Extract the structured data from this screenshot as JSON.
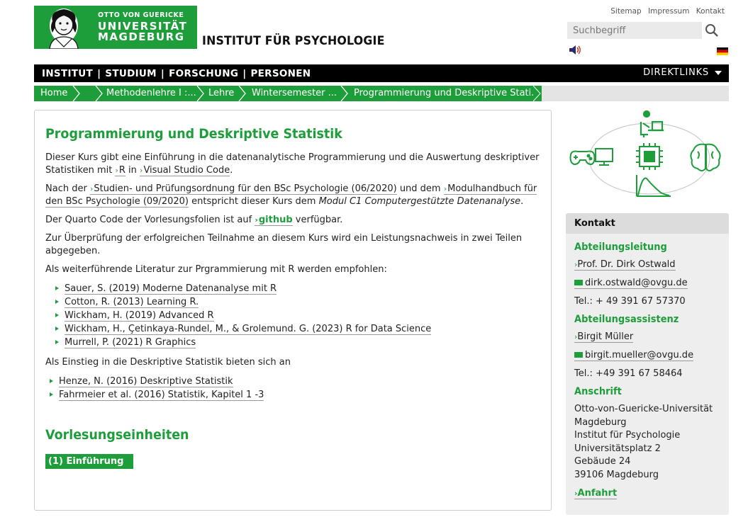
{
  "header": {
    "logo_small": "OTTO VON GUERICKE",
    "logo_line1": "UNIVERSITÄT",
    "logo_line2": "MAGDEBURG",
    "institute_title": "INSTITUT FÜR PSYCHOLOGIE",
    "toplinks": [
      "Sitemap",
      "Impressum",
      "Kontakt"
    ],
    "search_placeholder": "Suchbegriff"
  },
  "mainnav": {
    "items": [
      "INSTITUT",
      "STUDIUM",
      "FORSCHUNG",
      "PERSONEN"
    ],
    "direktlinks": "DIREKTLINKS"
  },
  "breadcrumb": [
    "Home",
    "",
    "Methodenlehre I :...",
    "Lehre",
    "Wintersemester ...",
    "Programmierung und Deskriptive Stati..."
  ],
  "main": {
    "title": "Programmierung und Deskriptive Statistik",
    "p1_a": "Dieser Kurs gibt eine Einführung in die datenanalytische Programmierung und die Auswertung deskriptiver Statistiken mit ",
    "p1_link1": "R",
    "p1_b": " in ",
    "p1_link2": "Visual Studio Code",
    "p1_c": ".",
    "p2_a": "Nach der ",
    "p2_link1": "Studien- und Prüfungsordnung für den BSc Psychologie (06/2020)",
    "p2_b": " und dem ",
    "p2_link2": "Modulhandbuch für den BSc Psychologie (09/2020)",
    "p2_c": " entspricht dieser Kurs dem ",
    "p2_em": "Modul C1 Computergestützte Datenanalyse",
    "p2_d": ".",
    "p3_a": "Der Quarto Code der Vorlesungsfolien ist auf ",
    "p3_link": "github",
    "p3_b": " verfügbar.",
    "p4": "Zur Überprüfung der erfolgreichen Teilnahme an diesem Kurs wird ein Leistungsnachweis in zwei Teilen abgegeben.",
    "p5": "Als weiterführende Literatur zur Prgrammierung mit R werden empfohlen:",
    "literature": [
      "Sauer, S. (2019) Moderne Datenanalyse mit R",
      "Cotton, R. (2013) Learning R.",
      "Wickham, H. (2019) Advanced R",
      "Wickham, H., Çetinkaya-Rundel, M., & Grolemund. G. (2023) R for Data Science",
      "Murrell, P. (2021) R Graphics"
    ],
    "p6": "Als Einstieg in die Deskriptive Statistik bieten sich an",
    "intro_literature": [
      "Henze, N. (2016) Deskriptive Statistik",
      "Fahrmeier et al. (2016) Statistik, Kapitel 1 -3"
    ],
    "section_title": "Vorlesungseinheiten",
    "unit_button": "(1) Einführung"
  },
  "kontakt": {
    "title": "Kontakt",
    "leitung_title": "Abteilungsleitung",
    "leitung_name": "Prof. Dr. Dirk Ostwald",
    "leitung_email": "dirk.ostwald@ovgu.de",
    "leitung_tel": "Tel.: + 49 391 67 57370",
    "assistenz_title": "Abteilungsassistenz",
    "assistenz_name": "Birgit Müller",
    "assistenz_email": "birgit.mueller@ovgu.de",
    "assistenz_tel": "Tel.: +49 391 67 58464",
    "anschrift_title": "Anschrift",
    "address": [
      "Otto-von-Guericke-Universität",
      "Magdeburg",
      "Institut für Psychologie",
      "Universitätsplatz 2",
      "Gebäude 24",
      "39106 Magdeburg"
    ],
    "anfahrt": "Anfahrt"
  },
  "colors": {
    "brand_green": "#1e9e3a",
    "nav_black": "#000000"
  }
}
